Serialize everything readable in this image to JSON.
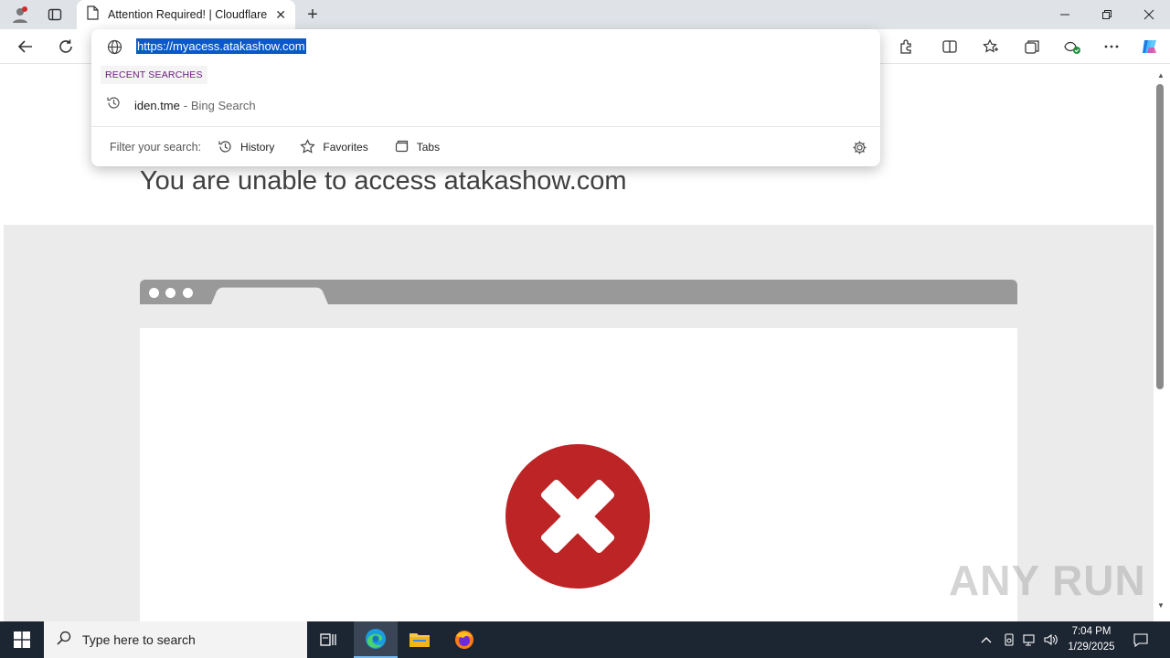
{
  "browser": {
    "tab_title": "Attention Required! | Cloudflare",
    "url_selected": "https://myacess.atakashow.com"
  },
  "dropdown": {
    "recent_label": "RECENT SEARCHES",
    "recent_items": [
      {
        "text": "iden.tme",
        "sub": "- Bing Search"
      }
    ],
    "filter_label": "Filter your search:",
    "filters": [
      "History",
      "Favorites",
      "Tabs"
    ]
  },
  "page": {
    "headline": "You are unable to access atakashow.com"
  },
  "taskbar": {
    "search_placeholder": "Type here to search",
    "time": "7:04 PM",
    "date": "1/29/2025"
  },
  "watermark": "ANY RUN",
  "colors": {
    "error_red": "#bd2426",
    "selection_blue": "#0a58ca",
    "taskbar": "#1c2532"
  }
}
